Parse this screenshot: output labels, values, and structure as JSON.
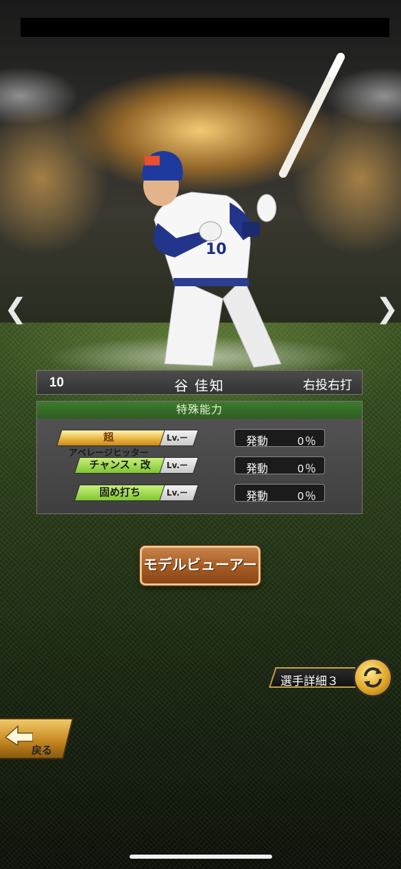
{
  "player": {
    "number": "10",
    "name": "谷 佳知",
    "handedness": "右投右打"
  },
  "abilities": {
    "header": "特殊能力",
    "items": [
      {
        "prefix": "超",
        "label": "アベレージヒッター",
        "lv": "Lv.ー",
        "rate_label": "発動",
        "rate_value": "0％"
      },
      {
        "prefix": "",
        "label": "チャンス・改",
        "lv": "Lv.ー",
        "rate_label": "発動",
        "rate_value": "0％"
      },
      {
        "prefix": "",
        "label": "固め打ち",
        "lv": "Lv.ー",
        "rate_label": "発動",
        "rate_value": "0％"
      }
    ]
  },
  "buttons": {
    "model_viewer": "モデルビューアー",
    "player_detail": "選手詳細３",
    "back": "戻る",
    "prev": "❮",
    "next": "❯"
  },
  "colors": {
    "ability_green": "#7fc634",
    "header_green": "#3f7a2e",
    "button_brown": "#a45a22",
    "gold": "#e1a82a"
  }
}
